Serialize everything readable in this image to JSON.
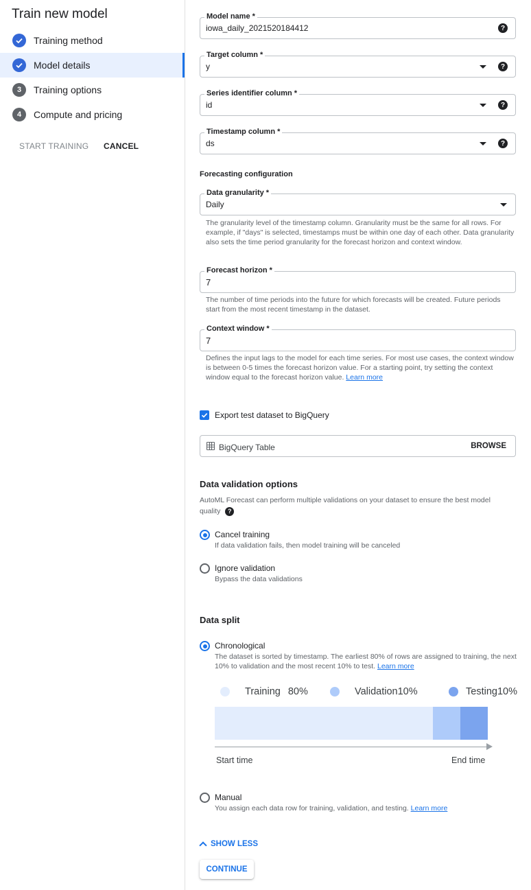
{
  "sidebar": {
    "title": "Train new model",
    "steps": [
      {
        "label": "Training method",
        "state": "done"
      },
      {
        "label": "Model details",
        "state": "done-active"
      },
      {
        "label": "Training options",
        "number": "3"
      },
      {
        "label": "Compute and pricing",
        "number": "4"
      }
    ],
    "start_training": "START TRAINING",
    "cancel": "CANCEL"
  },
  "form": {
    "model_name": {
      "label": "Model name *",
      "value": "iowa_daily_2021520184412"
    },
    "target_column": {
      "label": "Target column *",
      "value": "y"
    },
    "series_identifier": {
      "label": "Series identifier column *",
      "value": "id"
    },
    "timestamp_column": {
      "label": "Timestamp column *",
      "value": "ds"
    },
    "help_glyph": "?"
  },
  "forecasting": {
    "heading": "Forecasting configuration",
    "granularity": {
      "label": "Data granularity *",
      "value": "Daily",
      "hint": "The granularity level of the timestamp column. Granularity must be the same for all rows. For example, if \"days\" is selected, timestamps must be within one day of each other. Data granularity also sets the time period granularity for the forecast horizon and context window."
    },
    "horizon": {
      "label": "Forecast horizon *",
      "value": "7",
      "hint": "The number of time periods into the future for which forecasts will be created. Future periods start from the most recent timestamp in the dataset."
    },
    "context_window": {
      "label": "Context window *",
      "value": "7",
      "hint": "Defines the input lags to the model for each time series. For most use cases, the context window is between 0-5 times the forecast horizon value. For a starting point, try setting the context window equal to the forecast horizon value.",
      "link": "Learn more"
    }
  },
  "export": {
    "checkbox_label": "Export test dataset to BigQuery",
    "checked": true,
    "table_placeholder": "BigQuery Table",
    "browse": "BROWSE"
  },
  "validation": {
    "heading": "Data validation options",
    "description": "AutoML Forecast can perform multiple validations on your dataset to ensure the best model quality",
    "options": [
      {
        "label": "Cancel training",
        "desc": "If data validation fails, then model training will be canceled",
        "selected": true
      },
      {
        "label": "Ignore validation",
        "desc": "Bypass the data validations",
        "selected": false
      }
    ]
  },
  "data_split": {
    "heading": "Data split",
    "chronological": {
      "label": "Chronological",
      "desc": "The dataset is sorted by timestamp. The earliest 80% of rows are assigned to training, the next 10% to validation and the most recent 10% to test.",
      "link": "Learn more",
      "selected": true
    },
    "segments": [
      {
        "name": "Training",
        "pct_label": "80%",
        "fraction": 0.8,
        "color": "#e3edfd"
      },
      {
        "name": "Validation",
        "pct_label": "10%",
        "fraction": 0.1,
        "color": "#aecbfa"
      },
      {
        "name": "Testing",
        "pct_label": "10%",
        "fraction": 0.1,
        "color": "#7ba4ee"
      }
    ],
    "start_label": "Start time",
    "end_label": "End time",
    "manual": {
      "label": "Manual",
      "desc": "You assign each data row for training, validation, and testing.",
      "link": "Learn more",
      "selected": false
    }
  },
  "footer": {
    "show_less": "SHOW LESS",
    "continue": "CONTINUE"
  },
  "colors": {
    "accent": "#1a73e8",
    "active_bg": "#e8f0fe"
  }
}
